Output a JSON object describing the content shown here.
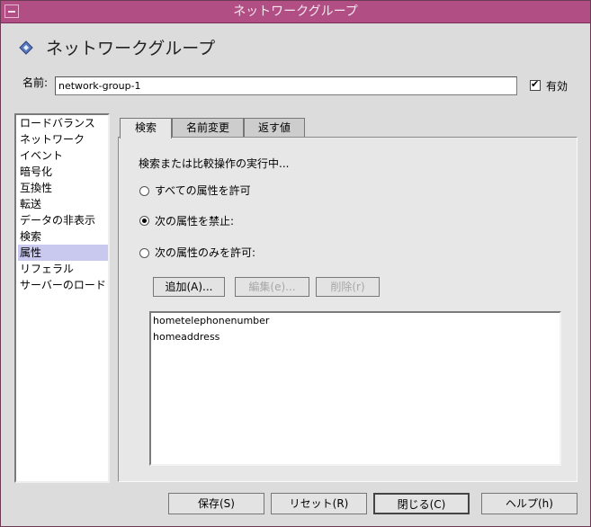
{
  "window": {
    "title": "ネットワークグループ"
  },
  "heading": "ネットワークグループ",
  "name_field": {
    "label": "名前:",
    "value": "network-group-1"
  },
  "enabled": {
    "label": "有効",
    "checked": true
  },
  "sidebar": {
    "items": [
      {
        "label": "ロードバランス"
      },
      {
        "label": "ネットワーク"
      },
      {
        "label": "イベント"
      },
      {
        "label": "暗号化"
      },
      {
        "label": "互換性"
      },
      {
        "label": "転送"
      },
      {
        "label": "データの非表示"
      },
      {
        "label": "検索"
      },
      {
        "label": "属性"
      },
      {
        "label": "リフェラル"
      },
      {
        "label": "サーバーのロード"
      }
    ],
    "selected": "属性"
  },
  "tabs": [
    {
      "label": "検索",
      "active": true
    },
    {
      "label": "名前変更",
      "active": false
    },
    {
      "label": "返す値",
      "active": false
    }
  ],
  "panel": {
    "description": "検索または比較操作の実行中...",
    "options": [
      {
        "label": "すべての属性を許可",
        "selected": false
      },
      {
        "label": "次の属性を禁止:",
        "selected": true
      },
      {
        "label": "次の属性のみを許可:",
        "selected": false
      }
    ],
    "buttons": {
      "add": "追加(A)...",
      "edit": "編集(e)...",
      "delete": "削除(r)"
    },
    "attributes": [
      "hometelephonenumber",
      "homeaddress"
    ]
  },
  "footer": {
    "save": "保存(S)",
    "reset": "リセット(R)",
    "close": "閉じる(C)",
    "help": "ヘルプ(h)"
  }
}
